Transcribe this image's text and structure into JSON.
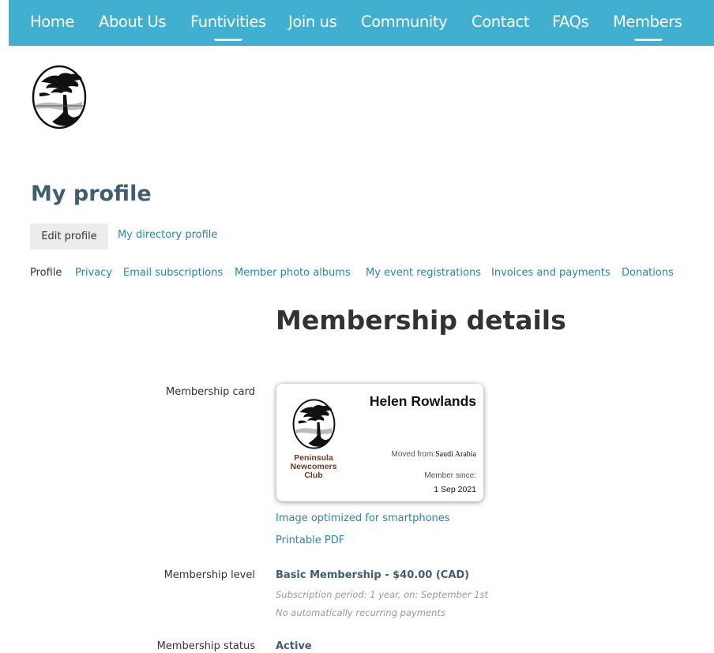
{
  "nav": {
    "items": [
      {
        "label": "Home"
      },
      {
        "label": "About Us"
      },
      {
        "label": "Funtivities"
      },
      {
        "label": "Join us"
      },
      {
        "label": "Community"
      },
      {
        "label": "Contact"
      },
      {
        "label": "FAQs"
      },
      {
        "label": "Members"
      }
    ],
    "has_submenu": [
      "Funtivities",
      "Members"
    ],
    "background_color": "#41afd0"
  },
  "page": {
    "title": "My profile",
    "subtabs": {
      "active": "Edit profile",
      "link": "My directory profile"
    },
    "profile_nav": {
      "current": "Profile",
      "links": [
        "Privacy",
        "Email subscriptions",
        "Member photo albums",
        "My event registrations",
        "Invoices and payments",
        "Donations"
      ]
    },
    "section_title": "Membership details"
  },
  "membership": {
    "card_label": "Membership card",
    "card": {
      "name": "Helen Rowlands",
      "club_line1": "Peninsula",
      "club_line2": "Newcomers",
      "club_line3": "Club",
      "moved_from_label": "Moved from:",
      "moved_from_value": "Saudi Arabia",
      "member_since_label": "Member since:",
      "member_since_value": "1 Sep 2021"
    },
    "card_links": {
      "smartphone": "Image optimized for smartphones",
      "pdf": "Printable PDF"
    },
    "level_label": "Membership level",
    "level_value": "Basic Membership - $40.00 (CAD)",
    "level_note1": "Subscription period: 1 year, on: September 1st",
    "level_note2": "No automatically recurring payments",
    "status_label": "Membership status",
    "status_value": "Active"
  },
  "colors": {
    "heading": "#3f5e73",
    "link": "#2a85a8",
    "card_club": "#6b3b24"
  },
  "icons": {
    "logo": "tree-logo-icon"
  }
}
